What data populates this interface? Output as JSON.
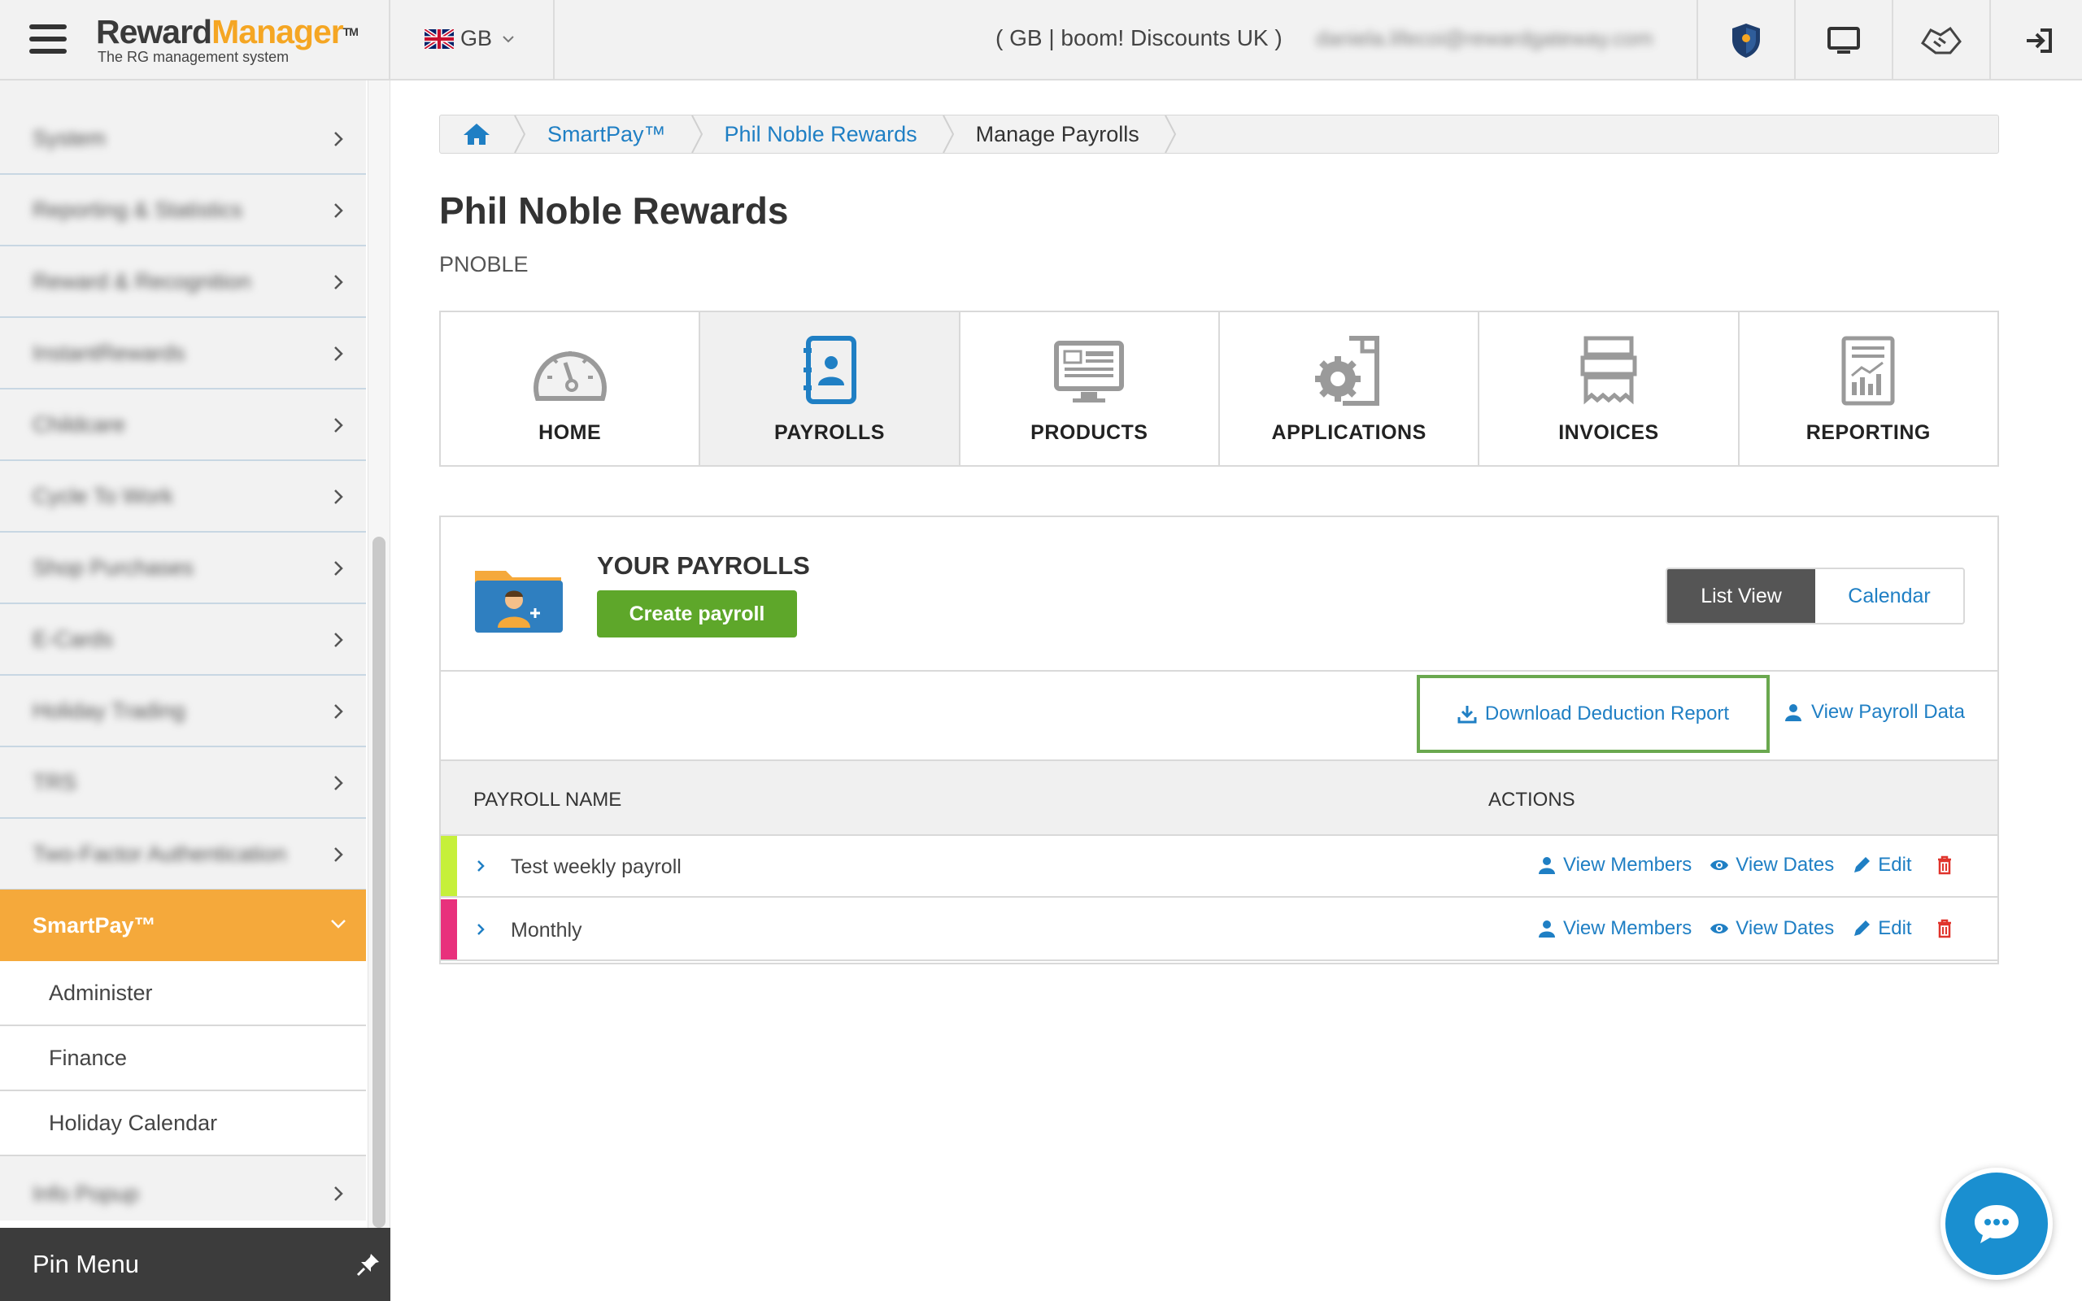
{
  "header": {
    "logo_part1": "Reward",
    "logo_part2": "Manager",
    "logo_tm": "TM",
    "logo_tagline": "The RG management system",
    "country_code": "GB",
    "account_label": "( GB | boom! Discounts UK )",
    "user_email_blurred": "daniela.lifecoi@rewardgateway.com",
    "icons": [
      "hamburger-icon",
      "shield-icon",
      "monitor-icon",
      "hands-icon",
      "sign-in-icon"
    ]
  },
  "sidebar": {
    "items": [
      {
        "label": "System"
      },
      {
        "label": "Reporting & Statistics"
      },
      {
        "label": "Reward & Recognition"
      },
      {
        "label": "InstantRewards"
      },
      {
        "label": "Childcare"
      },
      {
        "label": "Cycle To Work"
      },
      {
        "label": "Shop Purchases"
      },
      {
        "label": "E-Cards"
      },
      {
        "label": "Holiday Trading"
      },
      {
        "label": "TRS"
      },
      {
        "label": "Two-Factor Authentication"
      }
    ],
    "active_item": "SmartPay™",
    "sub_items": [
      "Administer",
      "Finance",
      "Holiday Calendar"
    ],
    "after_item": "Info Popup",
    "pin_menu": "Pin Menu"
  },
  "breadcrumb": {
    "items": [
      "SmartPay™",
      "Phil Noble Rewards",
      "Manage Payrolls"
    ]
  },
  "page": {
    "title": "Phil Noble Rewards",
    "code": "PNOBLE"
  },
  "tabs": [
    {
      "label": "HOME",
      "icon": "dashboard-gauge-icon"
    },
    {
      "label": "PAYROLLS",
      "icon": "contact-book-icon",
      "active": true
    },
    {
      "label": "PRODUCTS",
      "icon": "monitor-products-icon"
    },
    {
      "label": "APPLICATIONS",
      "icon": "gear-document-icon"
    },
    {
      "label": "INVOICES",
      "icon": "invoice-stack-icon"
    },
    {
      "label": "REPORTING",
      "icon": "report-chart-icon"
    }
  ],
  "payrolls": {
    "section_title": "YOUR PAYROLLS",
    "create_button": "Create payroll",
    "view_toggle": {
      "list": "List View",
      "calendar": "Calendar",
      "selected": "List View"
    },
    "download_report": "Download Deduction Report",
    "view_payroll_data": "View Payroll Data",
    "columns": {
      "name": "PAYROLL NAME",
      "actions": "ACTIONS"
    },
    "rows": [
      {
        "name": "Test weekly payroll",
        "color": "#c6f03a"
      },
      {
        "name": "Monthly",
        "color": "#e8317c"
      }
    ],
    "action_labels": {
      "members": "View Members",
      "dates": "View Dates",
      "edit": "Edit"
    }
  },
  "colors": {
    "accent_orange": "#f5a93b",
    "link_blue": "#1f7fc4",
    "create_green": "#5ea72a",
    "highlight_green": "#6aa84f",
    "delete_red": "#e0342c",
    "chat_blue": "#1a8fd0"
  }
}
